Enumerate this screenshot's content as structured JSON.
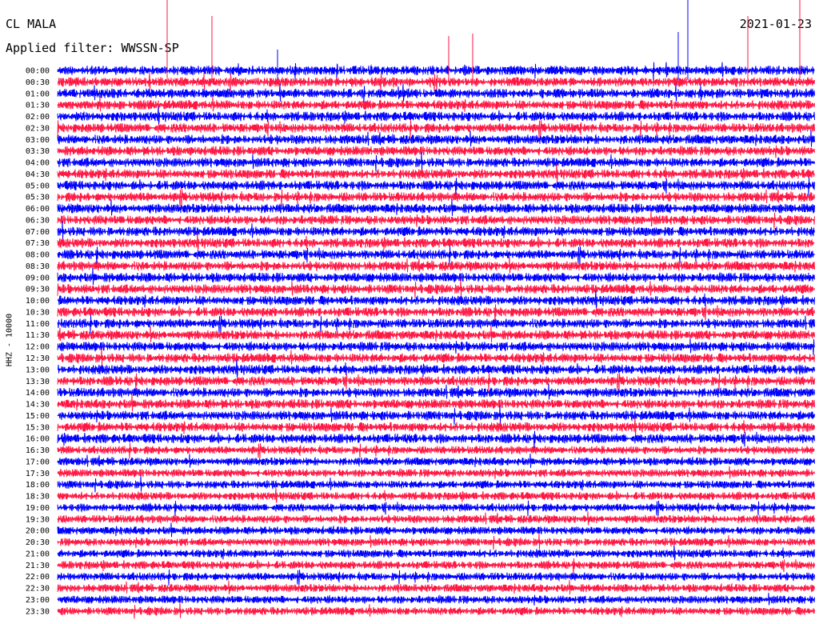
{
  "header": {
    "station": "CL MALA",
    "filter": "Applied filter: WWSSN-SP",
    "date": "2021-01-23"
  },
  "chart_data": {
    "type": "line",
    "title": "CL MALA",
    "subtitle": "Applied filter: WWSSN-SP",
    "date": "2021-01-23",
    "ylabel": "HHZ - 10000",
    "xlabel": "",
    "colors": [
      "#0000ff",
      "#ff1744"
    ],
    "row_labels": [
      "00:00",
      "00:30",
      "01:00",
      "01:30",
      "02:00",
      "02:30",
      "03:00",
      "03:30",
      "04:00",
      "04:30",
      "05:00",
      "05:30",
      "06:00",
      "06:30",
      "07:00",
      "07:30",
      "08:00",
      "08:30",
      "09:00",
      "09:30",
      "10:00",
      "10:30",
      "11:00",
      "11:30",
      "12:00",
      "12:30",
      "13:00",
      "13:30",
      "14:00",
      "14:30",
      "15:00",
      "15:30",
      "16:00",
      "16:30",
      "17:00",
      "17:30",
      "18:00",
      "18:30",
      "19:00",
      "19:30",
      "20:00",
      "20:30",
      "21:00",
      "21:30",
      "22:00",
      "22:30",
      "23:00",
      "23:30"
    ],
    "grid": false
  }
}
